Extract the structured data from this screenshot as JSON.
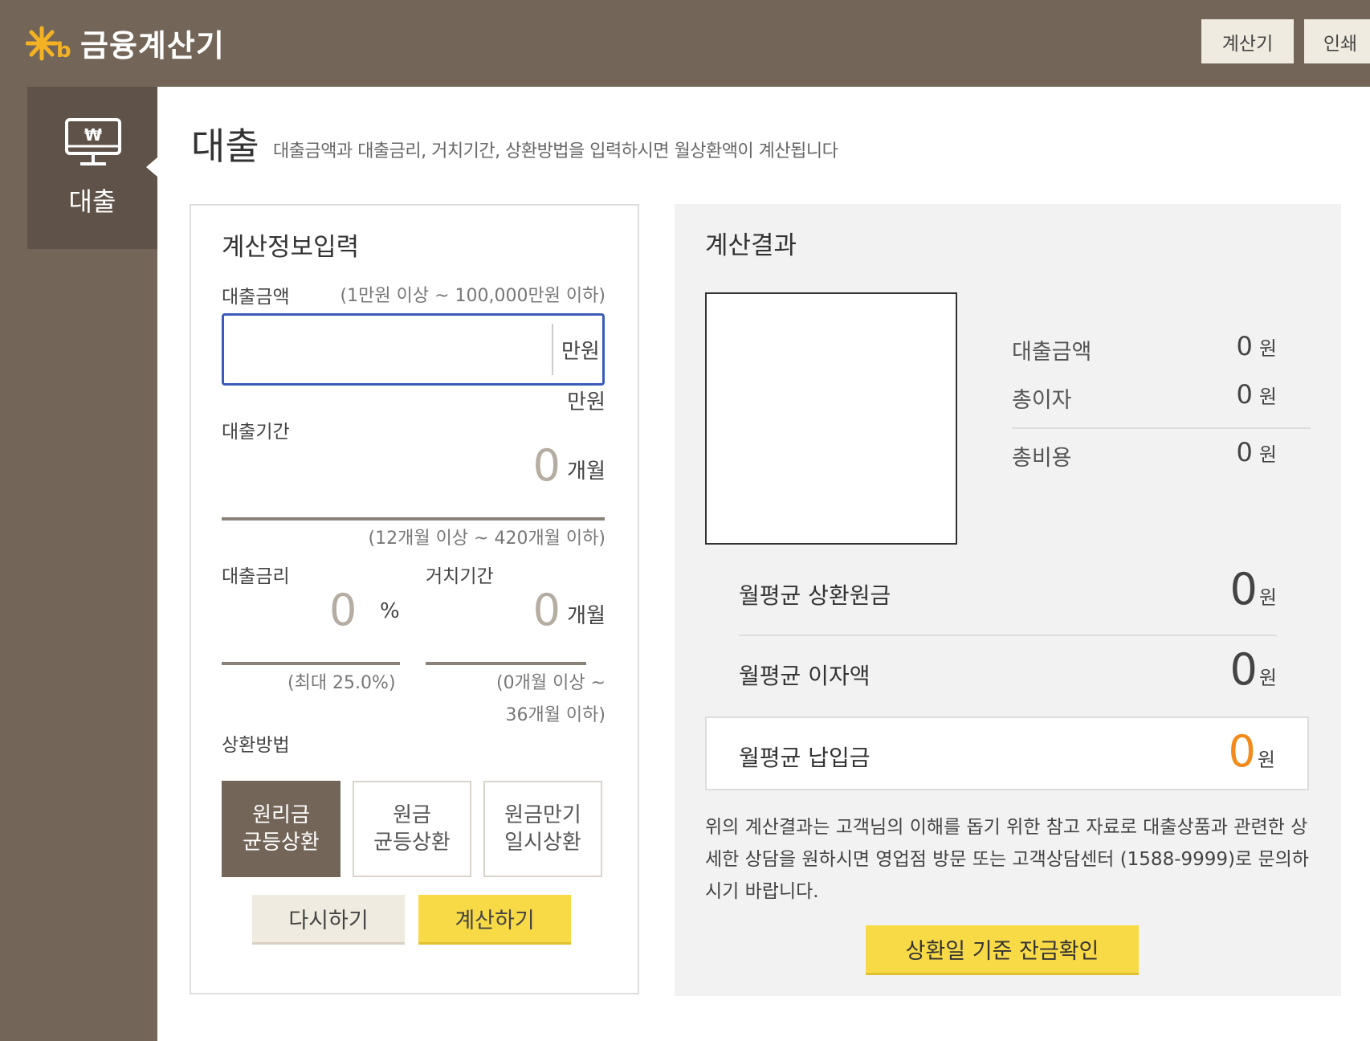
{
  "app": {
    "logo_text": "금융계산기",
    "header_buttons": {
      "calculator": "계산기",
      "print": "인쇄"
    }
  },
  "sidenav": {
    "item_label": "대출"
  },
  "page": {
    "title": "대출",
    "description": "대출금액과 대출금리, 거치기간, 상환방법을 입력하시면 월상환액이 계산됩니다"
  },
  "input_panel": {
    "title": "계산정보입력",
    "loan_amount": {
      "label": "대출금액",
      "range_hint": "(1만원 이상 ~ 100,000만원 이하)",
      "value": "",
      "unit": "만원",
      "unit_below": "만원"
    },
    "loan_period": {
      "label": "대출기간",
      "value": "0",
      "unit": "개월",
      "range_hint": "(12개월 이상 ~ 420개월 이하)"
    },
    "interest_rate": {
      "label": "대출금리",
      "value": "0",
      "unit": "%",
      "range_hint": "(최대 25.0%)"
    },
    "grace_period": {
      "label": "거치기간",
      "value": "0",
      "unit": "개월",
      "range_hint_line1": "(0개월 이상 ~",
      "range_hint_line2": "36개월 이하)"
    },
    "repayment_method": {
      "label": "상환방법",
      "options": [
        {
          "line1": "원리금",
          "line2": "균등상환",
          "selected": true
        },
        {
          "line1": "원금",
          "line2": "균등상환",
          "selected": false
        },
        {
          "line1": "원금만기",
          "line2": "일시상환",
          "selected": false
        }
      ]
    },
    "buttons": {
      "reset": "다시하기",
      "calculate": "계산하기"
    }
  },
  "result_panel": {
    "title": "계산결과",
    "summary": [
      {
        "label": "대출금액",
        "value": "0",
        "unit": "원"
      },
      {
        "label": "총이자",
        "value": "0",
        "unit": "원"
      },
      {
        "label": "총비용",
        "value": "0",
        "unit": "원"
      }
    ],
    "monthly_principal": {
      "label": "월평균 상환원금",
      "value": "0",
      "unit": "원"
    },
    "monthly_interest": {
      "label": "월평균 이자액",
      "value": "0",
      "unit": "원"
    },
    "monthly_payment": {
      "label": "월평균 납입금",
      "value": "0",
      "unit": "원"
    },
    "notice": "위의 계산결과는 고객님의 이해를 돕기 위한 참고 자료로 대출상품과 관련한 상세한 상담을 원하시면 영업점 방문 또는 고객상담센터 (1588-9999)로 문의하시기 바랍니다.",
    "balance_button": "상환일 기준 잔금확인"
  },
  "colors": {
    "brand_brown": "#736659",
    "accent_yellow": "#f8da47",
    "highlight_orange": "#f28b1c",
    "focus_blue": "#3a5bb8"
  }
}
